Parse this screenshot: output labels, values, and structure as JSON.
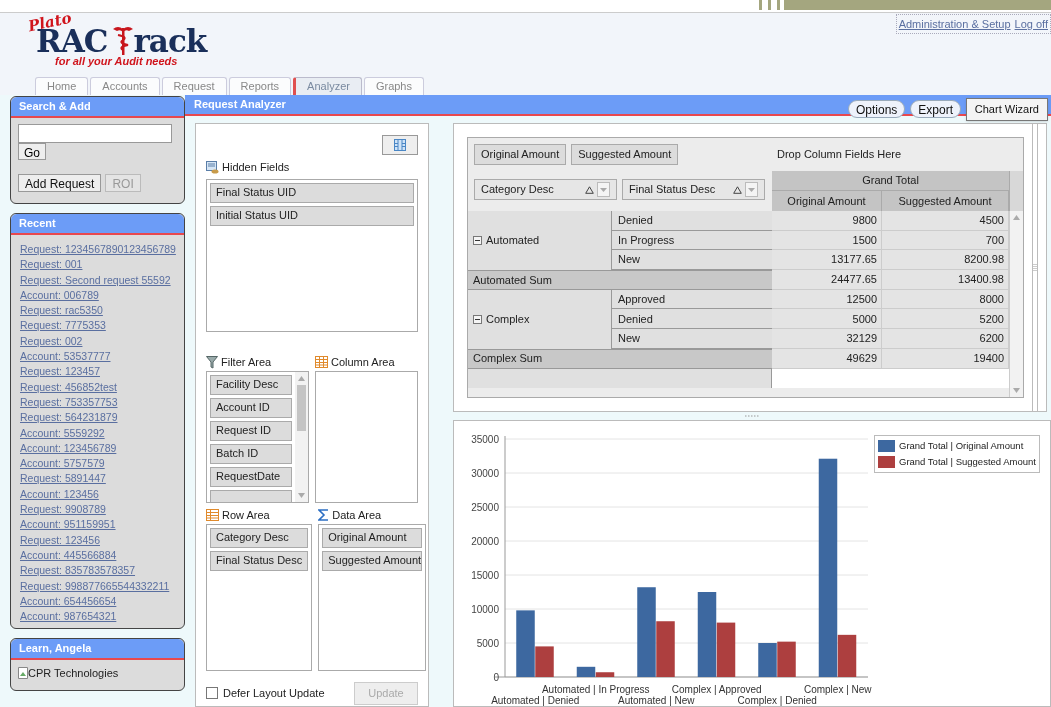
{
  "header": {
    "logo": {
      "brand_top": "Plato",
      "brand_left": "RAC",
      "brand_right": "rack",
      "tagline": "for all your Audit needs"
    },
    "links": [
      "Administration & Setup",
      "Log off"
    ],
    "tabs": [
      {
        "label": "Home",
        "selected": false
      },
      {
        "label": "Accounts",
        "selected": false
      },
      {
        "label": "Request",
        "selected": false
      },
      {
        "label": "Reports",
        "selected": false
      },
      {
        "label": "Analyzer",
        "selected": true
      },
      {
        "label": "Graphs",
        "selected": false
      }
    ]
  },
  "sidebar": {
    "search": {
      "title": "Search & Add",
      "go": "Go",
      "buttons": [
        {
          "label": "Add Request",
          "disabled": false
        },
        {
          "label": "ROI",
          "disabled": true
        }
      ]
    },
    "recent": {
      "title": "Recent",
      "items": [
        "Request: 1234567890123456789",
        "Request: 001",
        "Request: Second request 55592",
        "Account: 006789",
        "Request: rac5350",
        "Request: 7775353",
        "Request: 002",
        "Account: 53537777",
        "Request: 123457",
        "Request: 456852test",
        "Request: 753357753",
        "Request: 564231879",
        "Account: 5559292",
        "Account: 123456789",
        "Account: 5757579",
        "Request: 5891447",
        "Account: 123456",
        "Request: 9908789",
        "Account: 951159951",
        "Request: 123456",
        "Account: 445566884",
        "Request: 835783578357",
        "Request: 998877665544332211",
        "Account: 654456654",
        "Account: 987654321"
      ]
    },
    "learn": {
      "title": "Learn, Angela",
      "image_alt": "CPR Technologies"
    }
  },
  "analyzer": {
    "title": "Request Analyzer",
    "buttons": [
      "Options",
      "Export"
    ],
    "tooltip": "Chart Wizard",
    "field_list": {
      "hidden_fields": {
        "title": "Hidden Fields",
        "items": [
          "Final Status UID",
          "Initial Status UID"
        ]
      },
      "filter_area": {
        "title": "Filter Area",
        "items": [
          "Facility Desc",
          "Account ID",
          "Request ID",
          "Batch ID",
          "RequestDate"
        ]
      },
      "column_area": {
        "title": "Column Area"
      },
      "row_area": {
        "title": "Row Area",
        "items": [
          "Category Desc",
          "Final Status Desc"
        ]
      },
      "data_area": {
        "title": "Data Area",
        "items": [
          "Original Amount",
          "Suggested Amount"
        ]
      },
      "defer": {
        "label": "Defer Layout Update",
        "checked": false
      },
      "update": {
        "label": "Update",
        "disabled": true
      }
    },
    "pivot": {
      "data_fields": [
        "Original Amount",
        "Suggested Amount"
      ],
      "column_hint": "Drop Column Fields Here",
      "row_fields": [
        "Category Desc",
        "Final Status Desc"
      ],
      "grand_total": "Grand Total",
      "value_columns": [
        "Original Amount",
        "Suggested Amount"
      ],
      "groups": [
        {
          "label": "Automated",
          "expanded": true,
          "rows": [
            {
              "status": "Denied",
              "values": [
                "9800",
                "4500"
              ]
            },
            {
              "status": "In Progress",
              "values": [
                "1500",
                "700"
              ]
            },
            {
              "status": "New",
              "values": [
                "13177.65",
                "8200.98"
              ]
            }
          ],
          "sum_label": "Automated Sum",
          "sum_values": [
            "24477.65",
            "13400.98"
          ]
        },
        {
          "label": "Complex",
          "expanded": true,
          "rows": [
            {
              "status": "Approved",
              "values": [
                "12500",
                "8000"
              ]
            },
            {
              "status": "Denied",
              "values": [
                "5000",
                "5200"
              ]
            },
            {
              "status": "New",
              "values": [
                "32129",
                "6200"
              ]
            }
          ],
          "sum_label": "Complex Sum",
          "sum_values": [
            "49629",
            "19400"
          ]
        }
      ]
    },
    "chart": {
      "chart_data": {
        "type": "bar",
        "categories": [
          "Automated | Denied",
          "Automated | In Progress",
          "Automated | New",
          "Complex | Approved",
          "Complex | Denied",
          "Complex | New"
        ],
        "series": [
          {
            "name": "Grand Total | Original Amount",
            "color": "#3d68a0",
            "values": [
              9800,
              1500,
              13200,
              12500,
              5000,
              32100
            ]
          },
          {
            "name": "Grand Total | Suggested Amount",
            "color": "#ad3f3f",
            "values": [
              4500,
              700,
              8200,
              8000,
              5200,
              6200
            ]
          }
        ],
        "ylim": [
          0,
          35000
        ],
        "grid": true,
        "legend": "right",
        "yticks": [
          0,
          5000,
          10000,
          15000,
          20000,
          25000,
          30000,
          35000
        ]
      }
    }
  }
}
